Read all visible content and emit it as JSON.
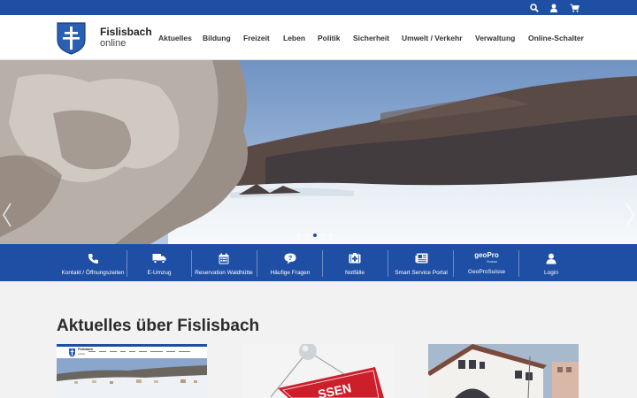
{
  "topbar": {
    "icons": [
      "search-icon",
      "user-icon",
      "cart-icon"
    ]
  },
  "header": {
    "logo_line1": "Fislisbach",
    "logo_line2": "online",
    "nav": [
      "Aktuelles",
      "Bildung",
      "Freizeit",
      "Leben",
      "Politik",
      "Sicherheit",
      "Umwelt / Verkehr",
      "Verwaltung",
      "Online-Schalter"
    ]
  },
  "hero": {
    "slides_total": 5,
    "active_slide": 3
  },
  "quicklinks": [
    {
      "label": "Kontakt / Öffnungszeiten",
      "icon": "phone-icon"
    },
    {
      "label": "E-Umzug",
      "icon": "truck-icon"
    },
    {
      "label": "Reservation Waldhütte",
      "icon": "calendar-icon"
    },
    {
      "label": "Häufige Fragen",
      "icon": "question-bubble-icon"
    },
    {
      "label": "Notfälle",
      "icon": "first-aid-icon"
    },
    {
      "label": "Smart Service Portal",
      "icon": "newspaper-icon"
    },
    {
      "label": "GeoProSuisse",
      "icon": "geopro-logo"
    },
    {
      "label": "Login",
      "icon": "user-icon"
    }
  ],
  "geopro_logo": {
    "main": "geoPro",
    "sub": "Suisse"
  },
  "section": {
    "title": "Aktuelles über Fislisbach"
  },
  "mini_site": {
    "logo_line1": "Fislisbach",
    "logo_line2": "online"
  },
  "card2_sign_text": "SSEN",
  "colors": {
    "brand_blue": "#1f4fa5",
    "background": "#f2f2f2",
    "sign_red": "#cc1f2b"
  }
}
